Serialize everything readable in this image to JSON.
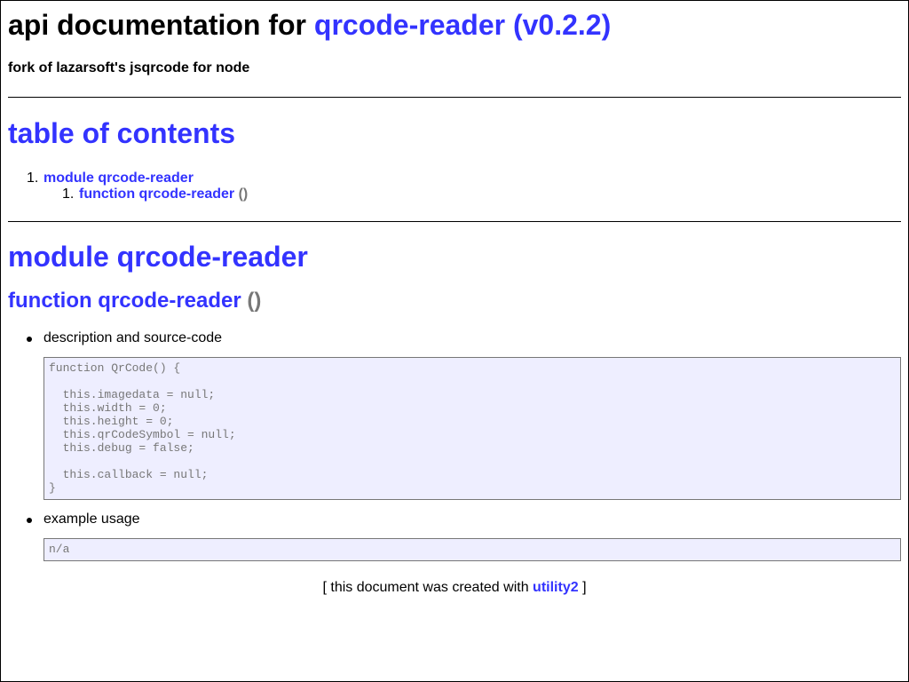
{
  "header": {
    "title_prefix": "api documentation for",
    "title_link": "qrcode-reader (v0.2.2)",
    "subtitle": "fork of lazarsoft's jsqrcode for node"
  },
  "toc": {
    "heading": "table of contents",
    "items": [
      {
        "number": "1.",
        "label": "module qrcode-reader",
        "children": [
          {
            "number": "1.",
            "label": "function qrcode-reader",
            "suffix": "()"
          }
        ]
      }
    ]
  },
  "module": {
    "heading": "module qrcode-reader",
    "function": {
      "name": "function qrcode-reader",
      "signature": "()",
      "sections": [
        {
          "label": "description and source-code",
          "code": "function QrCode() {\n\n  this.imagedata = null;\n  this.width = 0;\n  this.height = 0;\n  this.qrCodeSymbol = null;\n  this.debug = false;\n\n  this.callback = null;\n}"
        },
        {
          "label": "example usage",
          "code": "n/a"
        }
      ]
    }
  },
  "footer": {
    "prefix": "[ this document was created with",
    "link": "utility2",
    "suffix": "]"
  },
  "colors": {
    "link": "#3333ff",
    "code_bg": "#eeeeff",
    "muted": "#777777"
  }
}
